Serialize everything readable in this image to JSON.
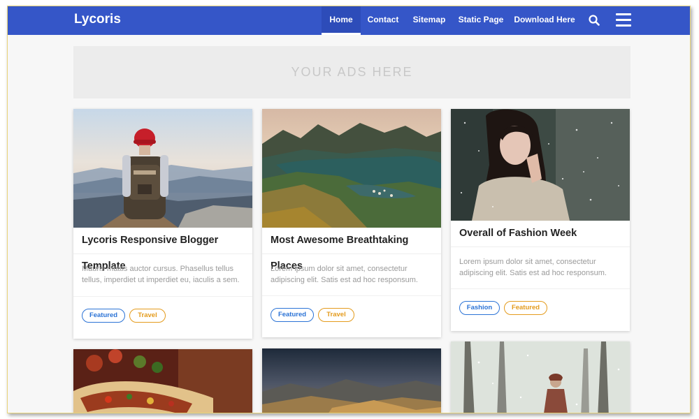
{
  "brand": "Lycoris",
  "nav": {
    "items": [
      "Home",
      "Contact",
      "Sitemap",
      "Static Page",
      "Download Here"
    ],
    "active": "Home",
    "icons": [
      "search-icon",
      "menu-icon"
    ]
  },
  "ads": {
    "text": "YOUR ADS HERE"
  },
  "colors": {
    "nav": "#3556c8",
    "tag_blue": "#2b73d6",
    "tag_orange": "#e49b1c"
  },
  "posts": [
    {
      "title": "Lycoris Responsive Blogger Template",
      "excerpt": "Mauris mattis auctor cursus. Phasellus tellus tellus, imperdiet ut imperdiet eu, iaculis a sem.",
      "tags": [
        "Featured",
        "Travel"
      ]
    },
    {
      "title": "Most Awesome Breathtaking Places",
      "excerpt": "Lorem ipsum dolor sit amet, consectetur adipiscing elit. Satis est ad hoc responsum.",
      "tags": [
        "Featured",
        "Travel"
      ]
    },
    {
      "title": "Overall of Fashion Week",
      "excerpt": "Lorem ipsum dolor sit amet, consectetur adipiscing elit. Satis est ad hoc responsum.",
      "tags": [
        "Fashion",
        "Featured"
      ]
    }
  ]
}
